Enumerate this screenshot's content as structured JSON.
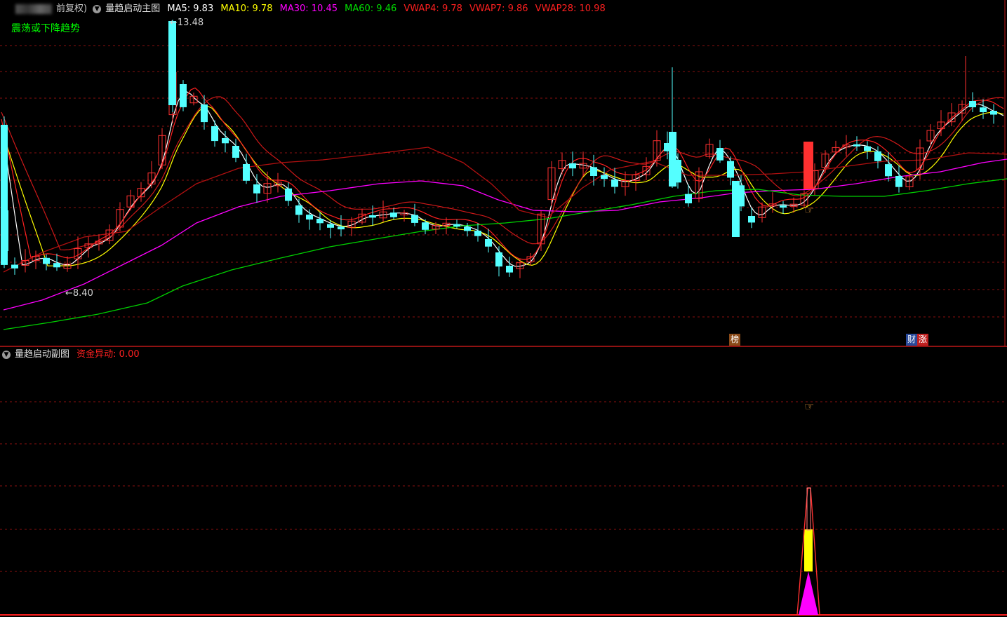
{
  "main_panel": {
    "stock_suffix": "前复权)",
    "indicator_title": "量趋启动主图",
    "ma": [
      {
        "label": "MA5: 9.83",
        "color": "#ffffff"
      },
      {
        "label": "MA10: 9.78",
        "color": "#ffff00"
      },
      {
        "label": "MA30: 10.45",
        "color": "#ff00ff"
      },
      {
        "label": "MA60: 9.46",
        "color": "#00e000"
      },
      {
        "label": "VWAP4: 9.78",
        "color": "#ff2020"
      },
      {
        "label": "VWAP7: 9.86",
        "color": "#ff2020"
      },
      {
        "label": "VWAP28: 10.98",
        "color": "#ff2020"
      }
    ],
    "trend_label": "震荡或下降趋势",
    "trend_color": "#00ff00",
    "high_label": "13.48",
    "low_label": "8.40",
    "badges": [
      {
        "text": "榜",
        "bg": "#8a4a18"
      },
      {
        "text": "财",
        "bg": "#2a4a9a"
      },
      {
        "text": "涨",
        "bg": "#c02020"
      }
    ]
  },
  "sub_panel": {
    "indicator_title": "量趋启动副图",
    "signal_label": "资金异动: 0.00",
    "signal_color": "#ff2020"
  },
  "colors": {
    "up_candle": "#ff3030",
    "down_candle": "#54ffff",
    "grid": "#8a1010",
    "separator": "#c01818"
  }
}
